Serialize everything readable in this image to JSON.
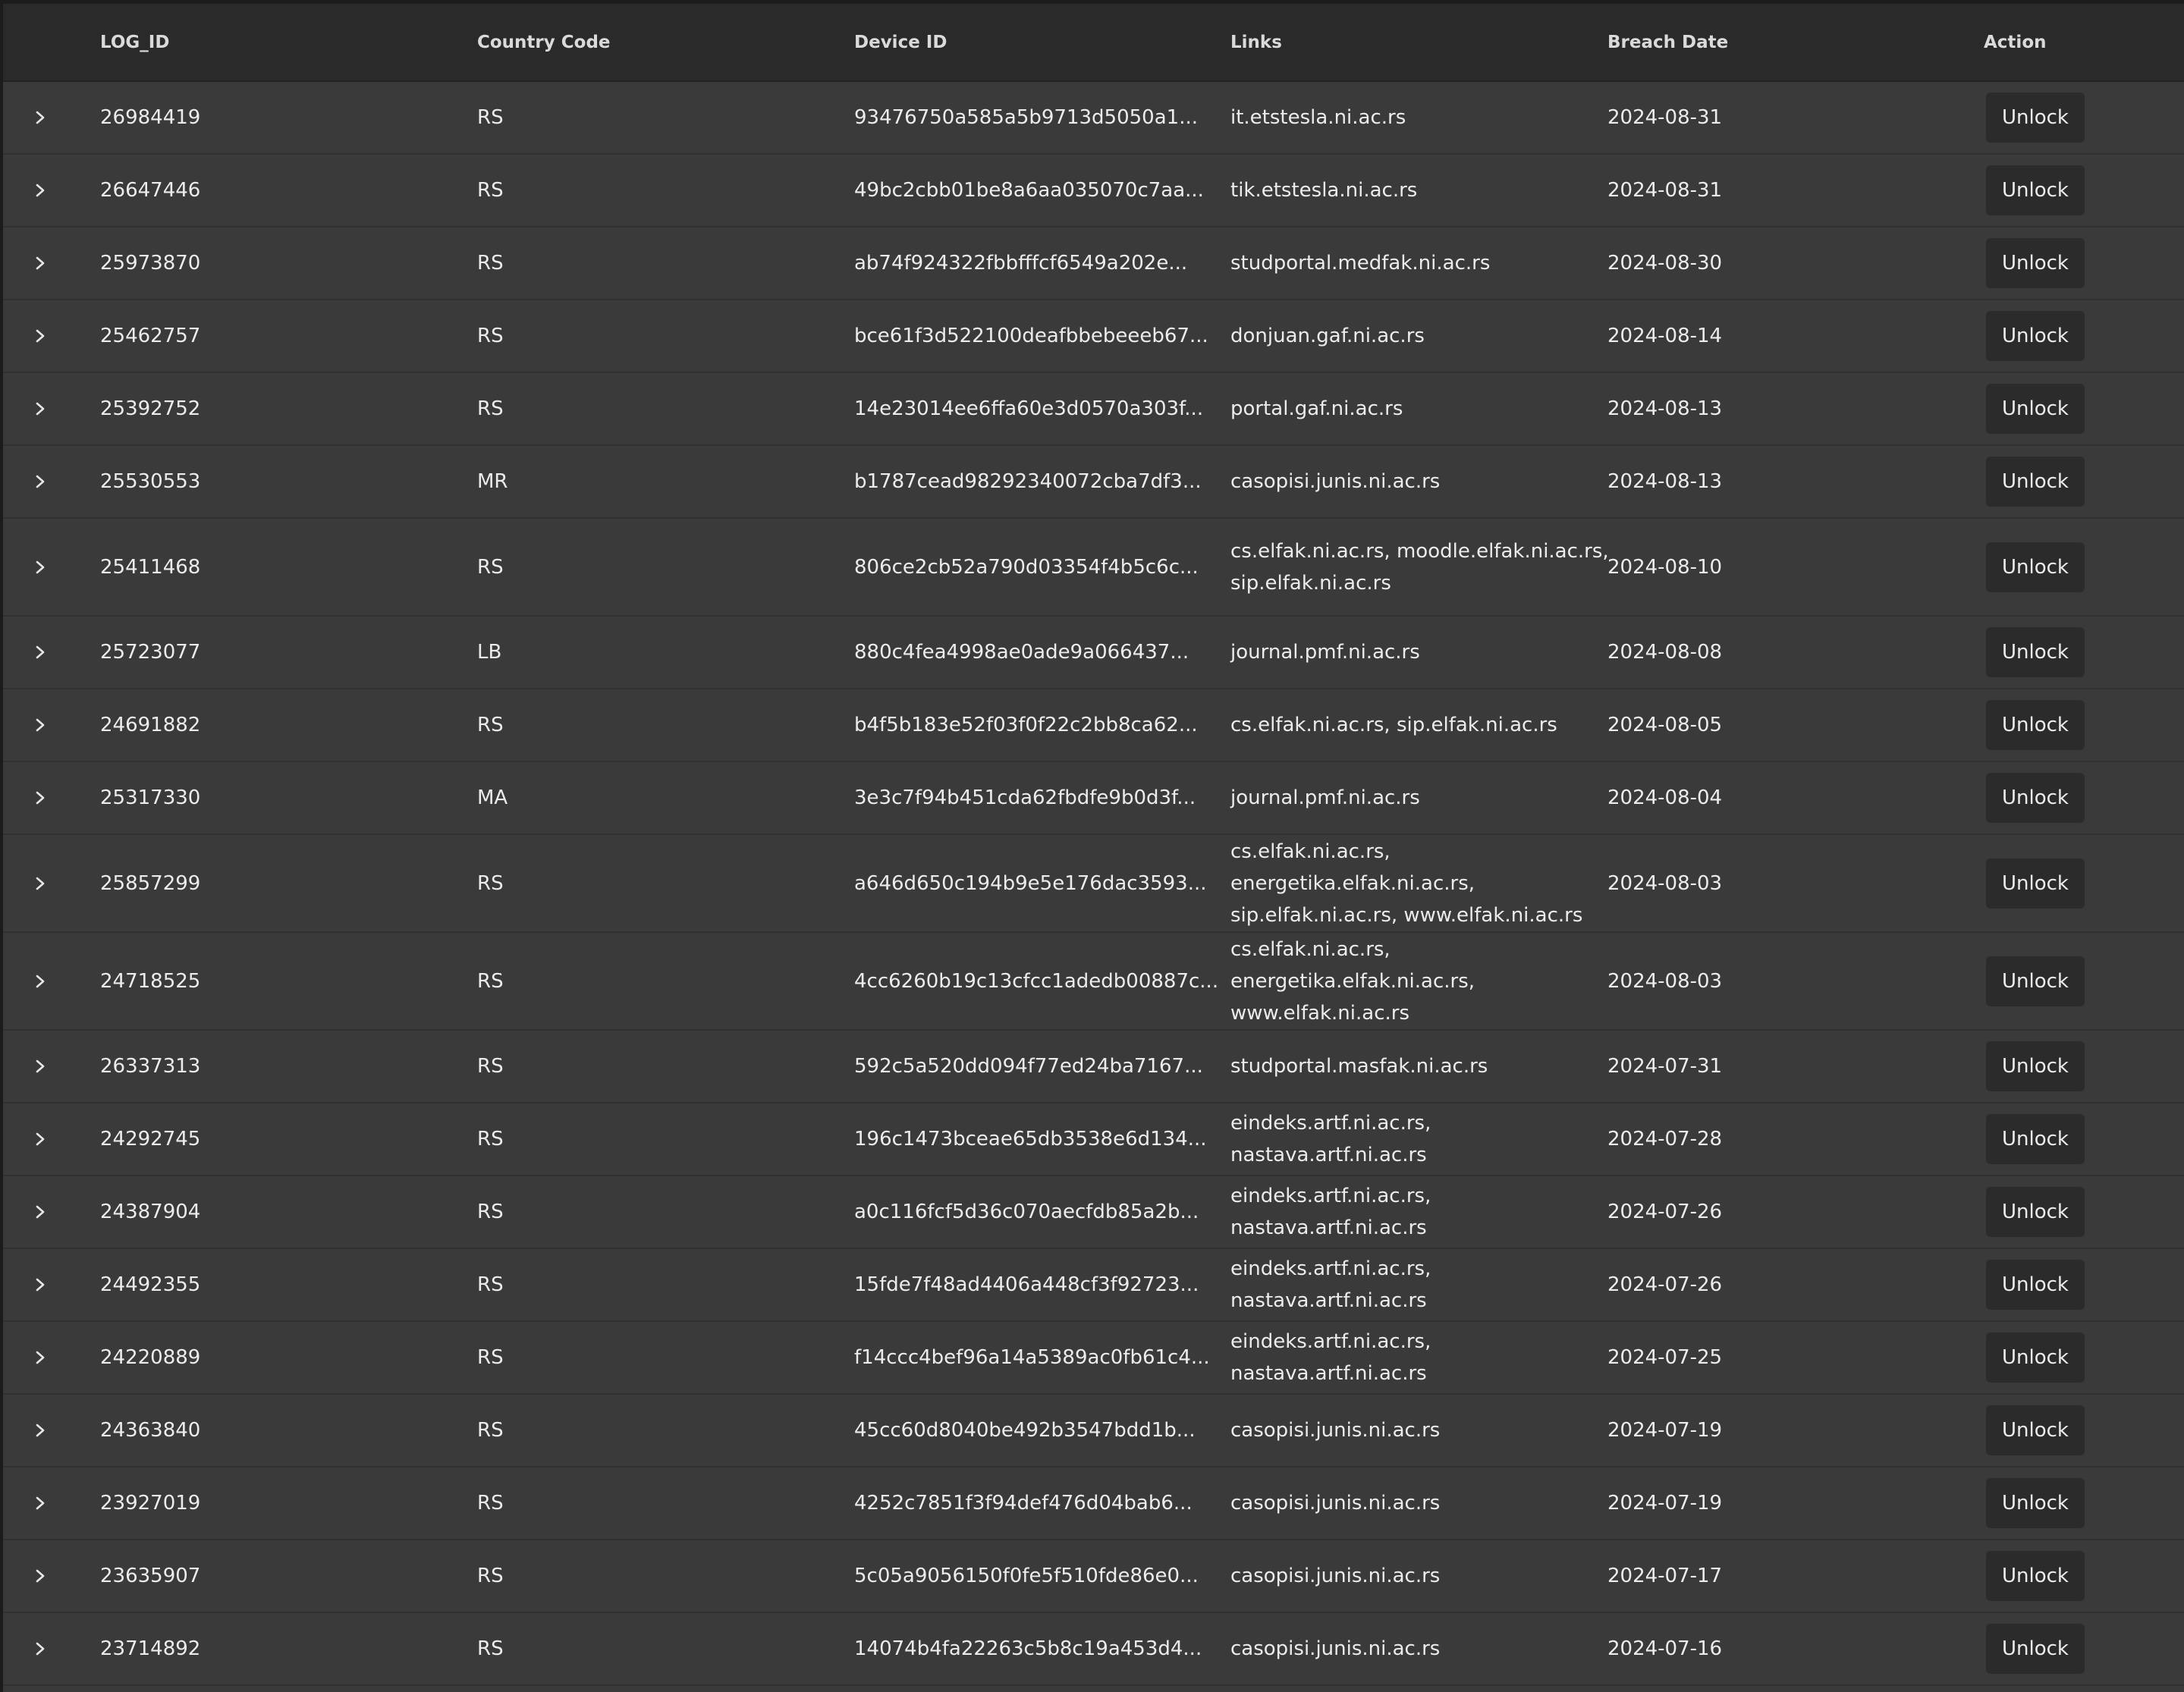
{
  "table": {
    "columns": [
      "LOG_ID",
      "Country Code",
      "Device ID",
      "Links",
      "Breach Date",
      "Action"
    ],
    "rows": [
      {
        "log_id": "26984419",
        "country": "RS",
        "device_id": "93476750a585a5b9713d5050a1...",
        "links": "it.etstesla.ni.ac.rs",
        "date": "2024-08-31",
        "action": "Unlock"
      },
      {
        "log_id": "26647446",
        "country": "RS",
        "device_id": "49bc2cbb01be8a6aa035070c7aa...",
        "links": "tik.etstesla.ni.ac.rs",
        "date": "2024-08-31",
        "action": "Unlock"
      },
      {
        "log_id": "25973870",
        "country": "RS",
        "device_id": "ab74f924322fbbfffcf6549a202e...",
        "links": "studportal.medfak.ni.ac.rs",
        "date": "2024-08-30",
        "action": "Unlock"
      },
      {
        "log_id": "25462757",
        "country": "RS",
        "device_id": "bce61f3d522100deafbbebeeeb67...",
        "links": "donjuan.gaf.ni.ac.rs",
        "date": "2024-08-14",
        "action": "Unlock"
      },
      {
        "log_id": "25392752",
        "country": "RS",
        "device_id": "14e23014ee6ffa60e3d0570a303f...",
        "links": "portal.gaf.ni.ac.rs",
        "date": "2024-08-13",
        "action": "Unlock"
      },
      {
        "log_id": "25530553",
        "country": "MR",
        "device_id": "b1787cead98292340072cba7df3...",
        "links": "casopisi.junis.ni.ac.rs",
        "date": "2024-08-13",
        "action": "Unlock"
      },
      {
        "log_id": "25411468",
        "country": "RS",
        "device_id": "806ce2cb52a790d03354f4b5c6c...",
        "links": "cs.elfak.ni.ac.rs, moodle.elfak.ni.ac.rs, sip.elfak.ni.ac.rs",
        "date": "2024-08-10",
        "action": "Unlock"
      },
      {
        "log_id": "25723077",
        "country": "LB",
        "device_id": "880c4fea4998ae0ade9a066437...",
        "links": "journal.pmf.ni.ac.rs",
        "date": "2024-08-08",
        "action": "Unlock"
      },
      {
        "log_id": "24691882",
        "country": "RS",
        "device_id": "b4f5b183e52f03f0f22c2bb8ca62...",
        "links": "cs.elfak.ni.ac.rs, sip.elfak.ni.ac.rs",
        "date": "2024-08-05",
        "action": "Unlock"
      },
      {
        "log_id": "25317330",
        "country": "MA",
        "device_id": "3e3c7f94b451cda62fbdfe9b0d3f...",
        "links": "journal.pmf.ni.ac.rs",
        "date": "2024-08-04",
        "action": "Unlock"
      },
      {
        "log_id": "25857299",
        "country": "RS",
        "device_id": "a646d650c194b9e5e176dac3593...",
        "links": "cs.elfak.ni.ac.rs, energetika.elfak.ni.ac.rs, sip.elfak.ni.ac.rs, www.elfak.ni.ac.rs",
        "date": "2024-08-03",
        "action": "Unlock"
      },
      {
        "log_id": "24718525",
        "country": "RS",
        "device_id": "4cc6260b19c13cfcc1adedb00887c...",
        "links": "cs.elfak.ni.ac.rs, energetika.elfak.ni.ac.rs, www.elfak.ni.ac.rs",
        "date": "2024-08-03",
        "action": "Unlock"
      },
      {
        "log_id": "26337313",
        "country": "RS",
        "device_id": "592c5a520dd094f77ed24ba7167...",
        "links": "studportal.masfak.ni.ac.rs",
        "date": "2024-07-31",
        "action": "Unlock"
      },
      {
        "log_id": "24292745",
        "country": "RS",
        "device_id": "196c1473bceae65db3538e6d134...",
        "links": "eindeks.artf.ni.ac.rs, nastava.artf.ni.ac.rs",
        "date": "2024-07-28",
        "action": "Unlock"
      },
      {
        "log_id": "24387904",
        "country": "RS",
        "device_id": "a0c116fcf5d36c070aecfdb85a2b...",
        "links": "eindeks.artf.ni.ac.rs, nastava.artf.ni.ac.rs",
        "date": "2024-07-26",
        "action": "Unlock"
      },
      {
        "log_id": "24492355",
        "country": "RS",
        "device_id": "15fde7f48ad4406a448cf3f92723...",
        "links": "eindeks.artf.ni.ac.rs, nastava.artf.ni.ac.rs",
        "date": "2024-07-26",
        "action": "Unlock"
      },
      {
        "log_id": "24220889",
        "country": "RS",
        "device_id": "f14ccc4bef96a14a5389ac0fb61c4...",
        "links": "eindeks.artf.ni.ac.rs, nastava.artf.ni.ac.rs",
        "date": "2024-07-25",
        "action": "Unlock"
      },
      {
        "log_id": "24363840",
        "country": "RS",
        "device_id": "45cc60d8040be492b3547bdd1b...",
        "links": "casopisi.junis.ni.ac.rs",
        "date": "2024-07-19",
        "action": "Unlock"
      },
      {
        "log_id": "23927019",
        "country": "RS",
        "device_id": "4252c7851f3f94def476d04bab6...",
        "links": "casopisi.junis.ni.ac.rs",
        "date": "2024-07-19",
        "action": "Unlock"
      },
      {
        "log_id": "23635907",
        "country": "RS",
        "device_id": "5c05a9056150f0fe5f510fde86e0...",
        "links": "casopisi.junis.ni.ac.rs",
        "date": "2024-07-17",
        "action": "Unlock"
      },
      {
        "log_id": "23714892",
        "country": "RS",
        "device_id": "14074b4fa22263c5b8c19a453d4...",
        "links": "casopisi.junis.ni.ac.rs",
        "date": "2024-07-16",
        "action": "Unlock"
      }
    ]
  },
  "icons": {
    "row_expand": "chevron-right-icon"
  },
  "colors": {
    "header_bg": "#2a2a2a",
    "row_bg": "#3a3a3a",
    "button_bg": "#2b2b2b",
    "text": "#ececec"
  }
}
